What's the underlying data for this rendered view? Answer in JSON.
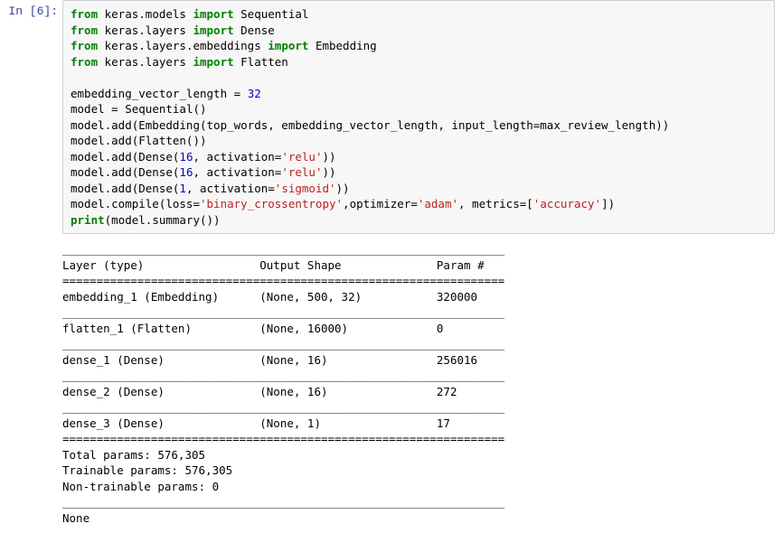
{
  "prompt": {
    "in_label": "In [6]:"
  },
  "code": {
    "l1a": "from",
    "l1b": " keras.models ",
    "l1c": "import",
    "l1d": " Sequential",
    "l2a": "from",
    "l2b": " keras.layers ",
    "l2c": "import",
    "l2d": " Dense",
    "l3a": "from",
    "l3b": " keras.layers.embeddings ",
    "l3c": "import",
    "l3d": " Embedding",
    "l4a": "from",
    "l4b": " keras.layers ",
    "l4c": "import",
    "l4d": " Flatten",
    "l5": "",
    "l6a": "embedding_vector_length ",
    "l6b": "=",
    "l6c": " ",
    "l6d": "32",
    "l7a": "model ",
    "l7b": "=",
    "l7c": " Sequential()",
    "l8a": "model.add(Embedding(top_words, embedding_vector_length, input_length",
    "l8b": "=",
    "l8c": "max_review_length))",
    "l9": "model.add(Flatten())",
    "l10a": "model.add(Dense(",
    "l10b": "16",
    "l10c": ", activation",
    "l10d": "=",
    "l10e": "'relu'",
    "l10f": "))",
    "l11a": "model.add(Dense(",
    "l11b": "16",
    "l11c": ", activation",
    "l11d": "=",
    "l11e": "'relu'",
    "l11f": "))",
    "l12a": "model.add(Dense(",
    "l12b": "1",
    "l12c": ", activation",
    "l12d": "=",
    "l12e": "'sigmoid'",
    "l12f": "))",
    "l13a": "model.compile(loss",
    "l13b": "=",
    "l13c": "'binary_crossentropy'",
    "l13d": ",optimizer",
    "l13e": "=",
    "l13f": "'adam'",
    "l13g": ", metrics",
    "l13h": "=",
    "l13i": "[",
    "l13j": "'accuracy'",
    "l13k": "])",
    "l14a": "print",
    "l14b": "(model.summary())"
  },
  "output": {
    "summary": "_________________________________________________________________\nLayer (type)                 Output Shape              Param #   \n=================================================================\nembedding_1 (Embedding)      (None, 500, 32)           320000    \n_________________________________________________________________\nflatten_1 (Flatten)          (None, 16000)             0         \n_________________________________________________________________\ndense_1 (Dense)              (None, 16)                256016    \n_________________________________________________________________\ndense_2 (Dense)              (None, 16)                272       \n_________________________________________________________________\ndense_3 (Dense)              (None, 1)                 17        \n=================================================================\nTotal params: 576,305\nTrainable params: 576,305\nNon-trainable params: 0\n_________________________________________________________________\nNone"
  }
}
